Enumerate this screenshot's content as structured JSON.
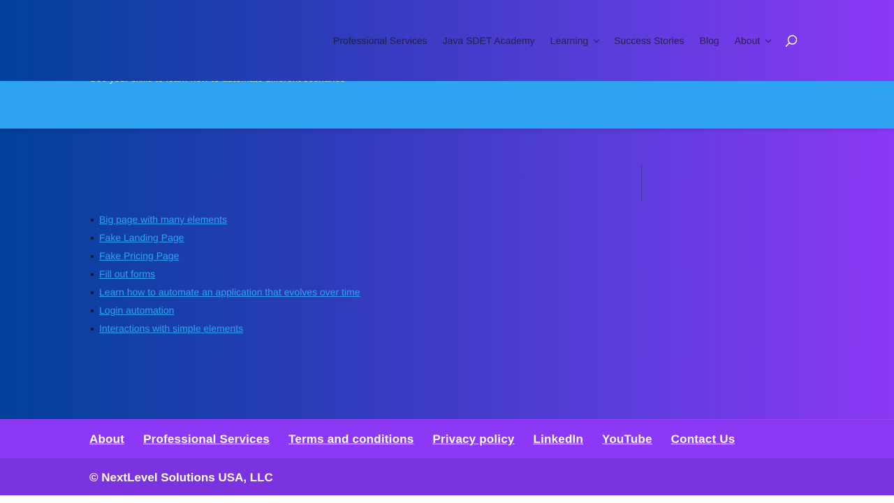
{
  "header": {
    "nav": [
      {
        "label": "Professional Services",
        "dropdown": false
      },
      {
        "label": "Java SDET Academy",
        "dropdown": false
      },
      {
        "label": "Learning",
        "dropdown": true
      },
      {
        "label": "Success Stories",
        "dropdown": false
      },
      {
        "label": "Blog",
        "dropdown": false
      },
      {
        "label": "About",
        "dropdown": true
      }
    ],
    "search_icon": "search-icon"
  },
  "hero": {
    "subtitle": "Use your skills to learn how to automate different scenarios"
  },
  "links": [
    "Big page with many elements",
    "Fake Landing Page",
    "Fake Pricing Page",
    "Fill out forms",
    "Learn how to automate an application that evolves over time",
    "Login automation",
    "Interactions with simple elements"
  ],
  "footer": {
    "links": [
      "About",
      "Professional Services",
      "Terms and conditions",
      "Privacy policy",
      "LinkedIn",
      "YouTube",
      "Contact Us"
    ],
    "copyright": "© NextLevel Solutions USA, LLC"
  },
  "colors": {
    "link": "#2ea3f2",
    "hero": "#2ea3f2",
    "footer": "#8c38f5",
    "bottom_bar": "#7b33e0"
  }
}
